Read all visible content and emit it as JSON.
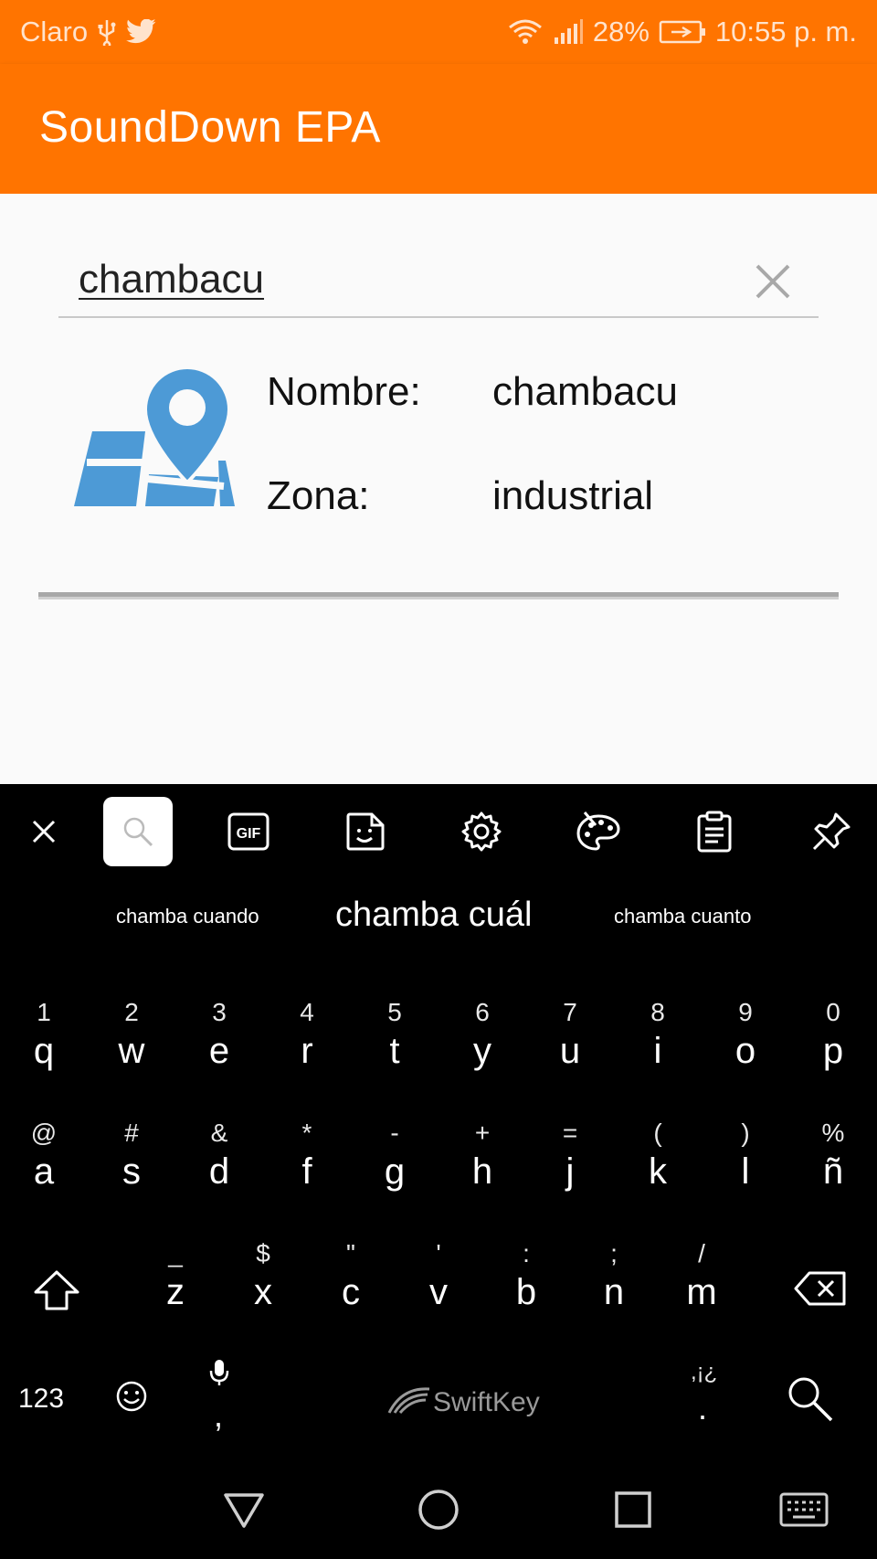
{
  "status_bar": {
    "carrier": "Claro",
    "battery": "28%",
    "time": "10:55 p. m."
  },
  "app": {
    "title": "SoundDown EPA"
  },
  "search": {
    "value": "chambacu"
  },
  "result": {
    "name_label": "Nombre:",
    "name_value": "chambacu",
    "zone_label": "Zona:",
    "zone_value": "industrial"
  },
  "colors": {
    "accent": "#ff7400",
    "map_icon": "#4d9ad6"
  },
  "keyboard": {
    "toolbar": [
      "close-icon",
      "search-icon",
      "gif-icon",
      "sticker-icon",
      "settings-icon",
      "theme-icon",
      "clipboard-icon",
      "pin-icon"
    ],
    "gif_label": "GIF",
    "suggestions": [
      "chamba cuando",
      "chamba cuál",
      "chamba cuanto"
    ],
    "row1": [
      {
        "alt": "1",
        "key": "q"
      },
      {
        "alt": "2",
        "key": "w"
      },
      {
        "alt": "3",
        "key": "e"
      },
      {
        "alt": "4",
        "key": "r"
      },
      {
        "alt": "5",
        "key": "t"
      },
      {
        "alt": "6",
        "key": "y"
      },
      {
        "alt": "7",
        "key": "u"
      },
      {
        "alt": "8",
        "key": "i"
      },
      {
        "alt": "9",
        "key": "o"
      },
      {
        "alt": "0",
        "key": "p"
      }
    ],
    "row2": [
      {
        "alt": "@",
        "key": "a"
      },
      {
        "alt": "#",
        "key": "s"
      },
      {
        "alt": "&",
        "key": "d"
      },
      {
        "alt": "*",
        "key": "f"
      },
      {
        "alt": "-",
        "key": "g"
      },
      {
        "alt": "+",
        "key": "h"
      },
      {
        "alt": "=",
        "key": "j"
      },
      {
        "alt": "(",
        "key": "k"
      },
      {
        "alt": ")",
        "key": "l"
      },
      {
        "alt": "%",
        "key": "ñ"
      }
    ],
    "row3": [
      {
        "alt": "_",
        "key": "z"
      },
      {
        "alt": "$",
        "key": "x"
      },
      {
        "alt": "\"",
        "key": "c"
      },
      {
        "alt": "'",
        "key": "v"
      },
      {
        "alt": ":",
        "key": "b"
      },
      {
        "alt": ";",
        "key": "n"
      },
      {
        "alt": "/",
        "key": "m"
      }
    ],
    "numbers_key": "123",
    "comma_key": ",",
    "space_brand": "SwiftKey",
    "punct_alt": ",¡¿",
    "period_key": "."
  }
}
